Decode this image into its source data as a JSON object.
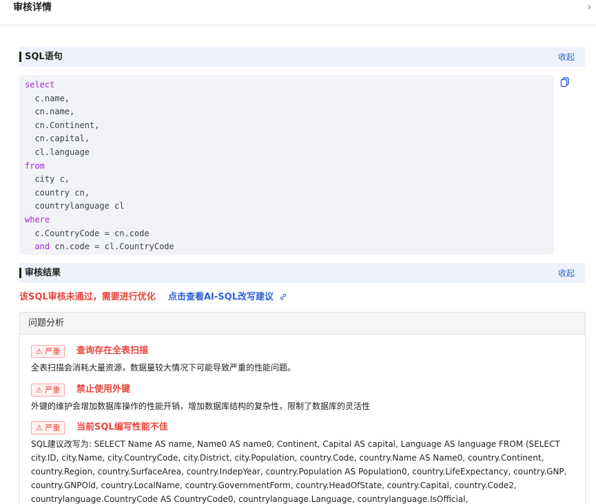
{
  "header": {
    "title": "审核详情",
    "close_glyph": "›"
  },
  "sql_section": {
    "label": "SQL语句",
    "collapse_label": "收起",
    "copy_icon": "copy-icon",
    "code_lines": [
      {
        "indent": "",
        "keyword": "select",
        "text": ""
      },
      {
        "indent": "  ",
        "keyword": "",
        "text": "c.name,"
      },
      {
        "indent": "  ",
        "keyword": "",
        "text": "cn.name,"
      },
      {
        "indent": "  ",
        "keyword": "",
        "text": "cn.Continent,"
      },
      {
        "indent": "  ",
        "keyword": "",
        "text": "cn.capital,"
      },
      {
        "indent": "  ",
        "keyword": "",
        "text": "cl.language"
      },
      {
        "indent": "",
        "keyword": "from",
        "text": ""
      },
      {
        "indent": "  ",
        "keyword": "",
        "text": "city c,"
      },
      {
        "indent": "  ",
        "keyword": "",
        "text": "country cn,"
      },
      {
        "indent": "  ",
        "keyword": "",
        "text": "countrylanguage cl"
      },
      {
        "indent": "",
        "keyword": "where",
        "text": ""
      },
      {
        "indent": "  ",
        "keyword": "",
        "text": "c.CountryCode = cn.code"
      },
      {
        "indent": "  ",
        "keyword": "and",
        "text": " cn.code = cl.CountryCode"
      }
    ]
  },
  "result_section": {
    "label": "审核结果",
    "collapse_label": "收起",
    "fail_message": "该SQL审核未通过，需要进行优化",
    "ai_link_label": "点击查看AI-SQL改写建议",
    "panel_title": "问题分析",
    "issues": [
      {
        "severity": "⚠ 严重",
        "title": "查询存在全表扫描",
        "description": "全表扫描会消耗大量资源，数据量较大情况下可能导致严重的性能问题。"
      },
      {
        "severity": "⚠ 严重",
        "title": "禁止使用外键",
        "description": "外键的维护会增加数据库操作的性能开销，增加数据库结构的复杂性，限制了数据库的灵活性"
      },
      {
        "severity": "⚠ 严重",
        "title": "当前SQL编写性能不佳",
        "description": "SQL建议改写为: SELECT Name AS name, Name0 AS name0, Continent, Capital AS capital, Language AS language FROM (SELECT city.ID, city.Name, city.CountryCode, city.District, city.Population, country.Code, country.Name AS Name0, country.Continent, country.Region, country.SurfaceArea, country.IndepYear, country.Population AS Population0, country.LifeExpectancy, country.GNP, country.GNPOld, country.LocalName, country.GovernmentForm, country.HeadOfState, country.Capital, country.Code2, countrylanguage.CountryCode AS CountryCode0, countrylanguage.Language, countrylanguage.IsOfficial, countrylanguage.Percentage FROM world.city, world.country,"
      }
    ]
  },
  "colors": {
    "accent_blue": "#2b5fd9",
    "danger_red": "#e8453c",
    "keyword_purple": "#a626d6",
    "section_bg": "#eef2fc"
  }
}
